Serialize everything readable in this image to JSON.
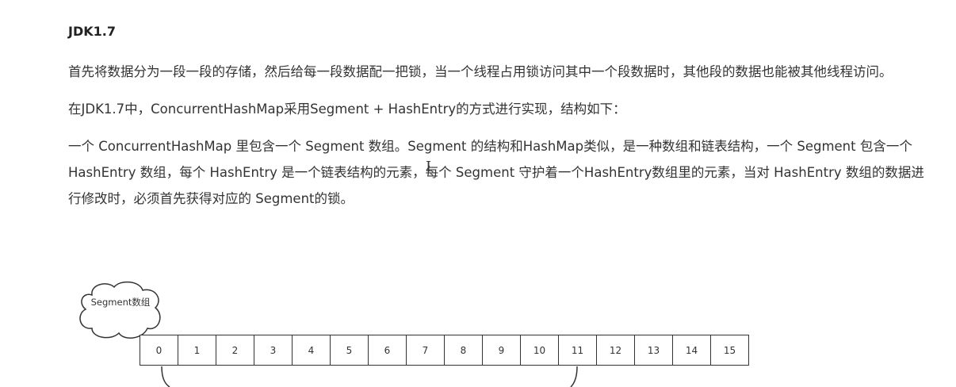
{
  "heading": "JDK1.7",
  "paragraphs": [
    "首先将数据分为一段一段的存储，然后给每一段数据配一把锁，当一个线程占用锁访问其中一个段数据时，其他段的数据也能被其他线程访问。",
    "在JDK1.7中，ConcurrentHashMap采用Segment + HashEntry的方式进行实现，结构如下：",
    "一个 ConcurrentHashMap 里包含一个 Segment 数组。Segment 的结构和HashMap类似，是一种数组和链表结构，一个 Segment 包含一个 HashEntry 数组，每个 HashEntry 是一个链表结构的元素，每个 Segment 守护着一个HashEntry数组里的元素，当对 HashEntry 数组的数据进行修改时，必须首先获得对应的 Segment的锁。"
  ],
  "diagram": {
    "cloud_label": "Segment数组",
    "cells": [
      "0",
      "1",
      "2",
      "3",
      "4",
      "5",
      "6",
      "7",
      "8",
      "9",
      "10",
      "11",
      "12",
      "13",
      "14",
      "15"
    ]
  },
  "cursor_icon": "text-cursor-icon"
}
